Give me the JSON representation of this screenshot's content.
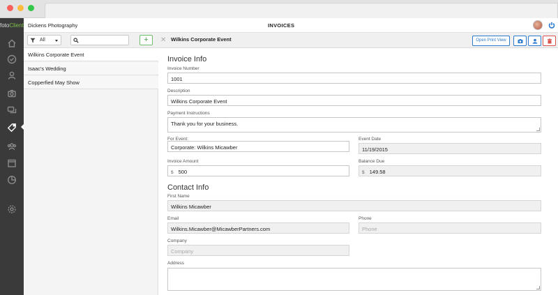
{
  "app": {
    "brand_prefix": "foto",
    "brand_suffix": "Client",
    "studio_name": "Dickens Photography",
    "section_title": "INVOICES"
  },
  "nav": {
    "icons": [
      "home-icon",
      "check-icon",
      "user-icon",
      "camera-icon",
      "chat-icon",
      "tag-icon",
      "group-icon",
      "calendar-icon",
      "chart-icon",
      "settings-icon"
    ],
    "active": "tag-icon"
  },
  "list": {
    "filter_value": "All",
    "search_placeholder": "",
    "add_label": "+",
    "items": [
      {
        "label": "Wilkins Corporate Event"
      },
      {
        "label": "Isaac's Wedding"
      },
      {
        "label": "Copperfied May Show"
      }
    ]
  },
  "detail": {
    "title": "Wilkins Corporate Event",
    "print_label": "Open Print View",
    "invoice_info_heading": "Invoice Info",
    "invoice_number_label": "Invoice Number",
    "invoice_number": "1001",
    "description_label": "Description",
    "description": "Wilkins Corporate Event",
    "payment_instructions_label": "Payment Instructions",
    "payment_instructions": "Thank you for your business.",
    "for_event_label": "For Event:",
    "for_event": "Corporate: Wilkins Micawber",
    "event_date_label": "Event Date",
    "event_date": "11/19/2015",
    "invoice_amount_label": "Invoice Amount",
    "currency_symbol": "$",
    "invoice_amount": "500",
    "balance_due_label": "Balance Due",
    "balance_due": "149.58",
    "contact_info_heading": "Contact Info",
    "first_name_label": "First Name",
    "first_name": "Wilkins Micawber",
    "email_label": "Email",
    "email": "Wilkins.Micawber@MicawberPartners.com",
    "phone_label": "Phone",
    "phone_placeholder": "Phone",
    "company_label": "Company",
    "company_placeholder": "Company",
    "address_label": "Address"
  },
  "colors": {
    "accent": "#2a7bd0",
    "danger": "#d9534f",
    "add": "#4aa64a",
    "sidebar": "#3a3a3a"
  }
}
